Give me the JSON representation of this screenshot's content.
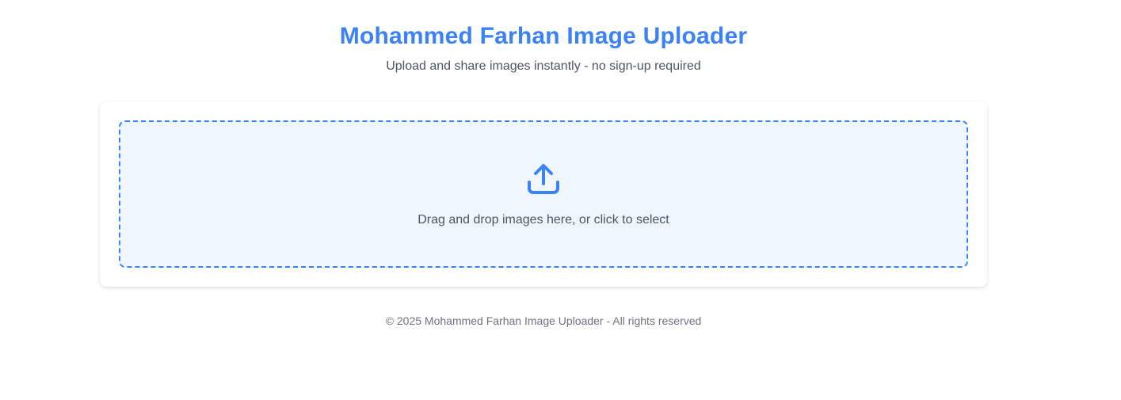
{
  "header": {
    "title": "Mohammed Farhan Image Uploader",
    "subtitle": "Upload and share images instantly - no sign-up required"
  },
  "dropzone": {
    "icon": "upload-icon",
    "text": "Drag and drop images here, or click to select"
  },
  "footer": {
    "text": "© 2025 Mohammed Farhan Image Uploader - All rights reserved"
  },
  "colors": {
    "accent": "#3b82f6",
    "dropzone_background": "#eff6ff",
    "text_secondary": "#4b5563",
    "text_muted": "#6b7280"
  }
}
